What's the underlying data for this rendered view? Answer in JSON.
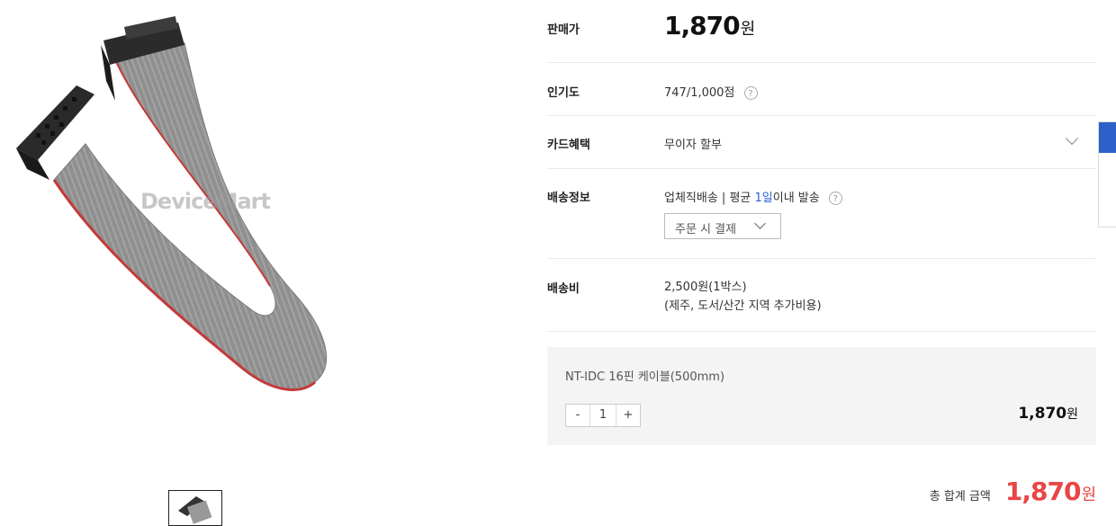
{
  "product_image": {
    "watermark": "DeviceMart"
  },
  "info": {
    "price": {
      "label": "판매가",
      "value": "1,870",
      "unit": "원"
    },
    "popularity": {
      "label": "인기도",
      "score": "747",
      "max": "/1,000점"
    },
    "card": {
      "label": "카드혜택",
      "value": "무이자 할부"
    },
    "shipping": {
      "label": "배송정보",
      "prefix": "업체직배송 | 평균 ",
      "days": "1일",
      "suffix": "이내 발송",
      "payment": "주문 시 결제"
    },
    "fee": {
      "label": "배송비",
      "line1": "2,500원(1박스)",
      "line2": "(제주, 도서/산간 지역 추가비용)"
    }
  },
  "option": {
    "name": "NT-IDC 16핀 케이블(500mm)",
    "minus": "-",
    "qty": "1",
    "plus": "+",
    "price": "1,870",
    "unit": "원"
  },
  "total": {
    "label": "총 합계 금액",
    "amount": "1,870",
    "unit": "원"
  },
  "colors": {
    "accent_red": "#e84646",
    "accent_blue": "#2f5fc9",
    "cable_gray": "#8e8e8e",
    "stripe_red": "#c43a3a"
  }
}
